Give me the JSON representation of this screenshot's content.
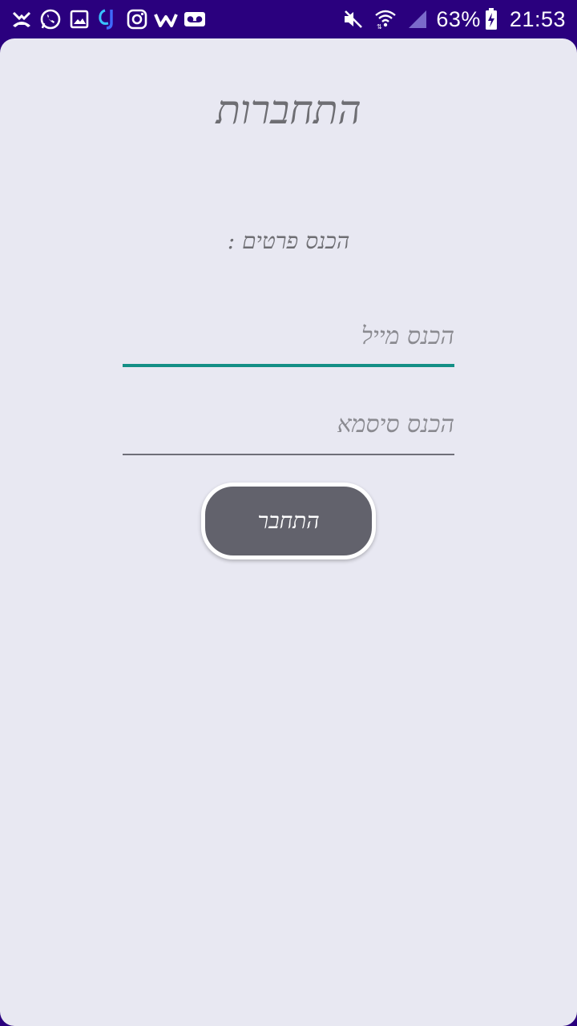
{
  "status_bar": {
    "left_icons": [
      "missed-call-icon",
      "whatsapp-icon",
      "gallery-icon",
      "app-notification-icon",
      "instagram-icon",
      "w-app-icon",
      "voicemail-icon"
    ],
    "right_icons": [
      "mute-icon",
      "wifi-icon",
      "signal-icon",
      "battery-charging-icon"
    ],
    "battery_percent": "63%",
    "time": "21:53"
  },
  "login": {
    "title": "התחברות",
    "prompt": "הכנס פרטים :",
    "email_placeholder": "הכנס מייל",
    "password_placeholder": "הכנס סיסמא",
    "button_label": "התחבר"
  },
  "colors": {
    "status_bar_bg": "#2a007e",
    "card_bg": "#e8e8f2",
    "accent_underline": "#148f86",
    "button_bg": "#62626c"
  }
}
